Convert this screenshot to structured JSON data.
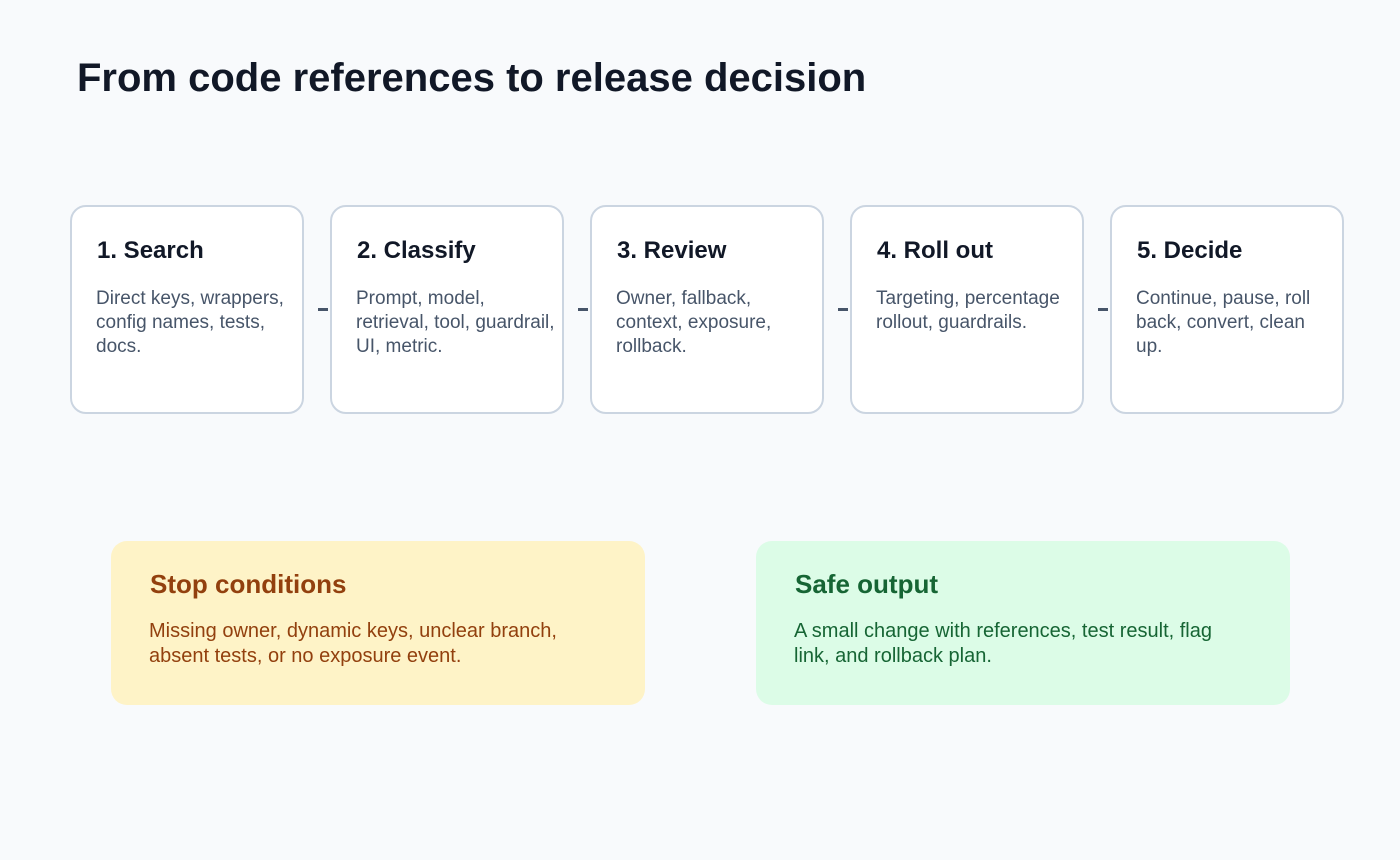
{
  "title": "From code references to release decision",
  "steps": [
    {
      "title": "1. Search",
      "description": "Direct keys, wrappers, config names, tests, docs."
    },
    {
      "title": "2. Classify",
      "description": "Prompt, model, retrieval, tool, guardrail, UI, metric."
    },
    {
      "title": "3. Review",
      "description": "Owner, fallback, context, exposure, rollback."
    },
    {
      "title": "4. Roll out",
      "description": "Targeting, percentage rollout, guardrails."
    },
    {
      "title": "5. Decide",
      "description": "Continue, pause, roll back, convert, clean up."
    }
  ],
  "stop_conditions": {
    "title": "Stop conditions",
    "description": "Missing owner, dynamic keys, unclear branch, absent tests, or no exposure event."
  },
  "safe_output": {
    "title": "Safe output",
    "description": "A small change with references, test result, flag link, and rollback plan."
  },
  "colors": {
    "background": "#f8fafc",
    "step_border": "#cbd5e1",
    "stop_bg": "#fef3c7",
    "stop_text": "#92400e",
    "safe_bg": "#dcfce7",
    "safe_text": "#166534"
  }
}
